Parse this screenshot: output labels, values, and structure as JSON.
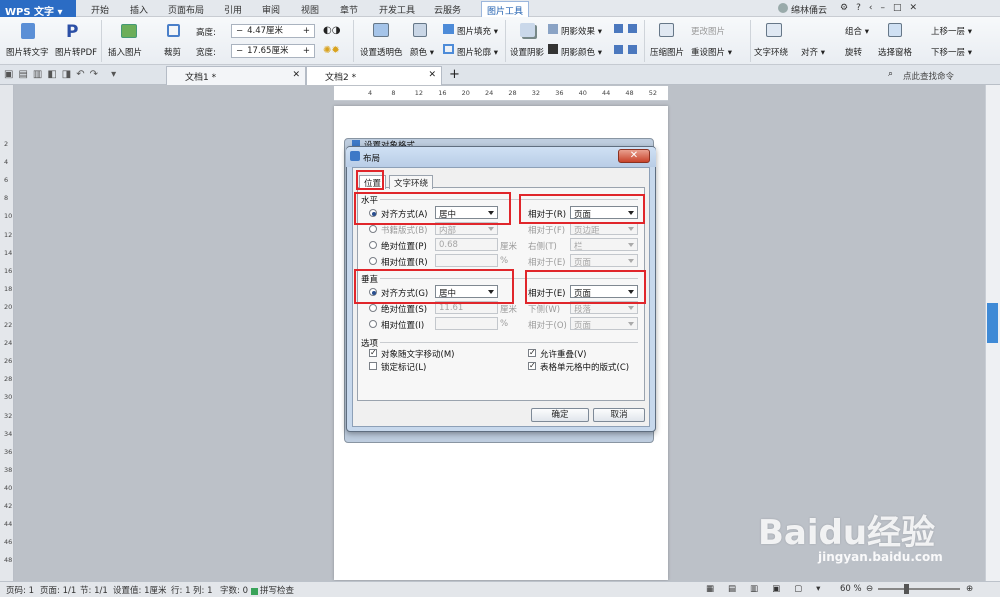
{
  "app": {
    "logo": "WPS 文字"
  },
  "menu": {
    "items": [
      "开始",
      "插入",
      "页面布局",
      "引用",
      "审阅",
      "视图",
      "章节",
      "开发工具",
      "云服务",
      "图片工具"
    ]
  },
  "account": {
    "name": "绵林俑云"
  },
  "ribbon": {
    "pic_to_text": "图片转文字",
    "pic_to_pdf": "图片转PDF",
    "insert_pic": "插入图片",
    "crop": "裁剪",
    "height_label": "高度:",
    "height_value": "4.47厘米",
    "width_label": "宽度:",
    "width_value": "17.65厘米",
    "set_transparent": "设置透明色",
    "color": "颜色",
    "pic_fill": "图片填充",
    "pic_outline": "图片轮廓",
    "set_shadow": "设置阴影",
    "shadow_effect": "阴影效果",
    "shadow_color": "阴影颜色",
    "compress": "压缩图片",
    "change_pic": "更改图片",
    "reset_pic": "重设图片",
    "text_wrap": "文字环绕",
    "align": "对齐",
    "rotate": "旋转",
    "group": "组合",
    "select_pane": "选择窗格",
    "bring_forward": "上移一层",
    "send_backward": "下移一层"
  },
  "tabs": {
    "doc1": "文档1 *",
    "doc2": "文档2 *",
    "search_placeholder": "点此查找命令"
  },
  "ruler": {
    "h": [
      "4",
      "8",
      "12",
      "16",
      "20",
      "24",
      "28",
      "32",
      "36",
      "40",
      "44",
      "48",
      "52"
    ],
    "v": [
      "2",
      "4",
      "6",
      "8",
      "10",
      "12",
      "14",
      "16",
      "18",
      "20",
      "22",
      "24",
      "26",
      "28",
      "30",
      "32",
      "34",
      "36",
      "38",
      "40",
      "42",
      "44",
      "46",
      "48"
    ]
  },
  "dialog": {
    "back_title": "设置对象格式",
    "title": "布局",
    "tab_position": "位置",
    "tab_wrap": "文字环绕",
    "horizontal": "水平",
    "h_align_label": "对齐方式(A)",
    "h_align_value": "居中",
    "h_rel_label": "相对于(R)",
    "h_rel_value": "页面",
    "h_book_label": "书籍版式(B)",
    "h_book_value": "内部",
    "h_book_rel_label": "相对于(F)",
    "h_book_rel_value": "页边距",
    "h_abs_label": "绝对位置(P)",
    "h_abs_value": "0.68",
    "h_abs_unit": "厘米",
    "h_abs_right_label": "右侧(T)",
    "h_abs_right_value": "栏",
    "h_rel_pos_label": "相对位置(R)",
    "h_rel_pos_unit": "%",
    "h_rel_pos_rel_label": "相对于(E)",
    "h_rel_pos_rel_value": "页面",
    "vertical": "垂直",
    "v_align_label": "对齐方式(G)",
    "v_align_value": "居中",
    "v_rel_label": "相对于(E)",
    "v_rel_value": "页面",
    "v_abs_label": "绝对位置(S)",
    "v_abs_value": "11.61",
    "v_abs_unit": "厘米",
    "v_abs_below_label": "下侧(W)",
    "v_abs_below_value": "段落",
    "v_rel_pos_label": "相对位置(I)",
    "v_rel_pos_unit": "%",
    "v_rel_pos_rel_label": "相对于(O)",
    "v_rel_pos_rel_value": "页面",
    "options": "选项",
    "opt_move": "对象随文字移动(M)",
    "opt_lock": "锁定标记(L)",
    "opt_overlap": "允许重叠(V)",
    "opt_table": "表格单元格中的版式(C)",
    "ok": "确定",
    "cancel": "取消"
  },
  "status": {
    "page": "页码: 1",
    "pages": "页面: 1/1",
    "section": "节: 1/1",
    "setting": "设置值: 1厘米",
    "row": "行: 1",
    "col": "列: 1",
    "words": "字数: 0",
    "spell": "拼写检查",
    "zoom": "60 %"
  },
  "watermark": {
    "brand": "Baidu经验",
    "url": "jingyan.baidu.com"
  }
}
